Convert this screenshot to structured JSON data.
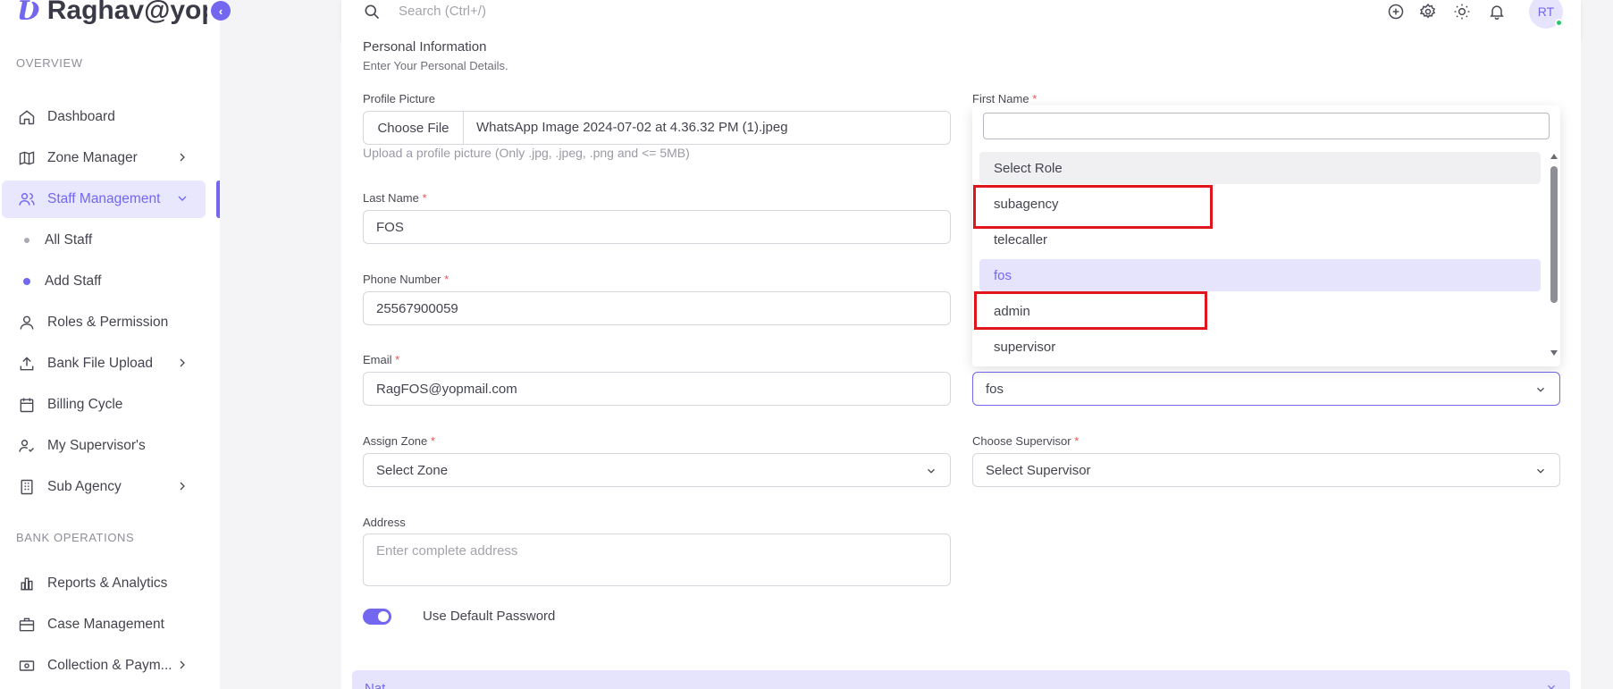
{
  "app": {
    "brand_logo": "Ʋ",
    "brand_name": "Raghav@yopmail"
  },
  "sidebar": {
    "sections": [
      {
        "label": "OVERVIEW"
      },
      {
        "label": "BANK OPERATIONS"
      }
    ],
    "items": [
      {
        "label": "Dashboard",
        "icon": "home-icon"
      },
      {
        "label": "Zone Manager",
        "icon": "map-icon",
        "has_submenu": true
      },
      {
        "label": "Staff Management",
        "icon": "users-icon",
        "has_submenu": true,
        "expanded": true,
        "active": true
      },
      {
        "label": "All Staff"
      },
      {
        "label": "Add Staff",
        "active": true
      },
      {
        "label": "Roles & Permission",
        "icon": "user-icon"
      },
      {
        "label": "Bank File Upload",
        "icon": "upload-icon",
        "has_submenu": true
      },
      {
        "label": "Billing Cycle",
        "icon": "calendar-icon"
      },
      {
        "label": "My Supervisor's",
        "icon": "user-check-icon"
      },
      {
        "label": "Sub Agency",
        "icon": "building-icon",
        "has_submenu": true
      },
      {
        "label": "Reports & Analytics",
        "icon": "chart-icon"
      },
      {
        "label": "Case Management",
        "icon": "briefcase-icon"
      },
      {
        "label": "Collection & Paym...",
        "icon": "cash-icon",
        "has_submenu": true
      }
    ]
  },
  "topbar": {
    "search_placeholder": "Search (Ctrl+/)",
    "avatar_initials": "RT"
  },
  "form": {
    "section_title": "Personal Information",
    "section_subtitle": "Enter Your Personal Details.",
    "profile_picture": {
      "label": "Profile Picture",
      "button": "Choose File",
      "file_name": "WhatsApp Image 2024-07-02 at 4.36.32 PM (1).jpeg",
      "helper": "Upload a profile picture (Only .jpg, .jpeg, .png and <= 5MB)"
    },
    "first_name": {
      "label": "First Name",
      "required": "*",
      "value": ""
    },
    "last_name": {
      "label": "Last Name",
      "required": "*",
      "value": "FOS"
    },
    "phone": {
      "label": "Phone Number",
      "required": "*",
      "value": "25567900059"
    },
    "email": {
      "label": "Email",
      "required": "*",
      "value": "RagFOS@yopmail.com"
    },
    "role": {
      "value": "fos"
    },
    "assign_zone": {
      "label": "Assign Zone",
      "required": "*",
      "value": "Select Zone"
    },
    "supervisor": {
      "label": "Choose Supervisor",
      "required": "*",
      "value": "Select Supervisor"
    },
    "address": {
      "label": "Address",
      "placeholder": "Enter complete address"
    },
    "default_password": {
      "label": "Use Default Password",
      "enabled": true
    },
    "next_section_label": "Nat"
  },
  "role_dropdown": {
    "search_value": "",
    "options": [
      {
        "label": "Select Role",
        "state": "placeholder"
      },
      {
        "label": "subagency",
        "state": "normal",
        "highlighted": true
      },
      {
        "label": "telecaller",
        "state": "normal"
      },
      {
        "label": "fos",
        "state": "selected"
      },
      {
        "label": "admin",
        "state": "normal",
        "highlighted": true
      },
      {
        "label": "supervisor",
        "state": "normal"
      }
    ]
  },
  "colors": {
    "accent": "#7367f0",
    "accent_light": "#e6e3fd",
    "required": "#ea5455",
    "highlight_box": "#e0161c",
    "online": "#28c76f"
  }
}
